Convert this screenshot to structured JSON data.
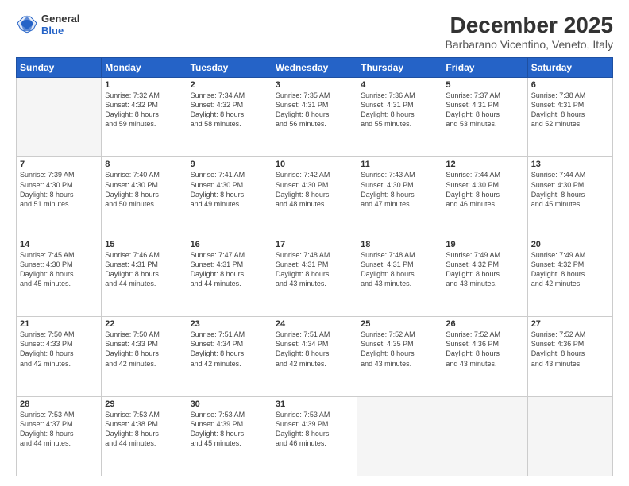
{
  "header": {
    "logo_general": "General",
    "logo_blue": "Blue",
    "month_title": "December 2025",
    "location": "Barbarano Vicentino, Veneto, Italy"
  },
  "weekdays": [
    "Sunday",
    "Monday",
    "Tuesday",
    "Wednesday",
    "Thursday",
    "Friday",
    "Saturday"
  ],
  "weeks": [
    [
      {
        "day": "",
        "info": "",
        "empty": true
      },
      {
        "day": "1",
        "info": "Sunrise: 7:32 AM\nSunset: 4:32 PM\nDaylight: 8 hours\nand 59 minutes."
      },
      {
        "day": "2",
        "info": "Sunrise: 7:34 AM\nSunset: 4:32 PM\nDaylight: 8 hours\nand 58 minutes."
      },
      {
        "day": "3",
        "info": "Sunrise: 7:35 AM\nSunset: 4:31 PM\nDaylight: 8 hours\nand 56 minutes."
      },
      {
        "day": "4",
        "info": "Sunrise: 7:36 AM\nSunset: 4:31 PM\nDaylight: 8 hours\nand 55 minutes."
      },
      {
        "day": "5",
        "info": "Sunrise: 7:37 AM\nSunset: 4:31 PM\nDaylight: 8 hours\nand 53 minutes."
      },
      {
        "day": "6",
        "info": "Sunrise: 7:38 AM\nSunset: 4:31 PM\nDaylight: 8 hours\nand 52 minutes."
      }
    ],
    [
      {
        "day": "7",
        "info": "Sunrise: 7:39 AM\nSunset: 4:30 PM\nDaylight: 8 hours\nand 51 minutes."
      },
      {
        "day": "8",
        "info": "Sunrise: 7:40 AM\nSunset: 4:30 PM\nDaylight: 8 hours\nand 50 minutes."
      },
      {
        "day": "9",
        "info": "Sunrise: 7:41 AM\nSunset: 4:30 PM\nDaylight: 8 hours\nand 49 minutes."
      },
      {
        "day": "10",
        "info": "Sunrise: 7:42 AM\nSunset: 4:30 PM\nDaylight: 8 hours\nand 48 minutes."
      },
      {
        "day": "11",
        "info": "Sunrise: 7:43 AM\nSunset: 4:30 PM\nDaylight: 8 hours\nand 47 minutes."
      },
      {
        "day": "12",
        "info": "Sunrise: 7:44 AM\nSunset: 4:30 PM\nDaylight: 8 hours\nand 46 minutes."
      },
      {
        "day": "13",
        "info": "Sunrise: 7:44 AM\nSunset: 4:30 PM\nDaylight: 8 hours\nand 45 minutes."
      }
    ],
    [
      {
        "day": "14",
        "info": "Sunrise: 7:45 AM\nSunset: 4:30 PM\nDaylight: 8 hours\nand 45 minutes."
      },
      {
        "day": "15",
        "info": "Sunrise: 7:46 AM\nSunset: 4:31 PM\nDaylight: 8 hours\nand 44 minutes."
      },
      {
        "day": "16",
        "info": "Sunrise: 7:47 AM\nSunset: 4:31 PM\nDaylight: 8 hours\nand 44 minutes."
      },
      {
        "day": "17",
        "info": "Sunrise: 7:48 AM\nSunset: 4:31 PM\nDaylight: 8 hours\nand 43 minutes."
      },
      {
        "day": "18",
        "info": "Sunrise: 7:48 AM\nSunset: 4:31 PM\nDaylight: 8 hours\nand 43 minutes."
      },
      {
        "day": "19",
        "info": "Sunrise: 7:49 AM\nSunset: 4:32 PM\nDaylight: 8 hours\nand 43 minutes."
      },
      {
        "day": "20",
        "info": "Sunrise: 7:49 AM\nSunset: 4:32 PM\nDaylight: 8 hours\nand 42 minutes."
      }
    ],
    [
      {
        "day": "21",
        "info": "Sunrise: 7:50 AM\nSunset: 4:33 PM\nDaylight: 8 hours\nand 42 minutes."
      },
      {
        "day": "22",
        "info": "Sunrise: 7:50 AM\nSunset: 4:33 PM\nDaylight: 8 hours\nand 42 minutes."
      },
      {
        "day": "23",
        "info": "Sunrise: 7:51 AM\nSunset: 4:34 PM\nDaylight: 8 hours\nand 42 minutes."
      },
      {
        "day": "24",
        "info": "Sunrise: 7:51 AM\nSunset: 4:34 PM\nDaylight: 8 hours\nand 42 minutes."
      },
      {
        "day": "25",
        "info": "Sunrise: 7:52 AM\nSunset: 4:35 PM\nDaylight: 8 hours\nand 43 minutes."
      },
      {
        "day": "26",
        "info": "Sunrise: 7:52 AM\nSunset: 4:36 PM\nDaylight: 8 hours\nand 43 minutes."
      },
      {
        "day": "27",
        "info": "Sunrise: 7:52 AM\nSunset: 4:36 PM\nDaylight: 8 hours\nand 43 minutes."
      }
    ],
    [
      {
        "day": "28",
        "info": "Sunrise: 7:53 AM\nSunset: 4:37 PM\nDaylight: 8 hours\nand 44 minutes."
      },
      {
        "day": "29",
        "info": "Sunrise: 7:53 AM\nSunset: 4:38 PM\nDaylight: 8 hours\nand 44 minutes."
      },
      {
        "day": "30",
        "info": "Sunrise: 7:53 AM\nSunset: 4:39 PM\nDaylight: 8 hours\nand 45 minutes."
      },
      {
        "day": "31",
        "info": "Sunrise: 7:53 AM\nSunset: 4:39 PM\nDaylight: 8 hours\nand 46 minutes."
      },
      {
        "day": "",
        "info": "",
        "empty": true
      },
      {
        "day": "",
        "info": "",
        "empty": true
      },
      {
        "day": "",
        "info": "",
        "empty": true
      }
    ]
  ]
}
